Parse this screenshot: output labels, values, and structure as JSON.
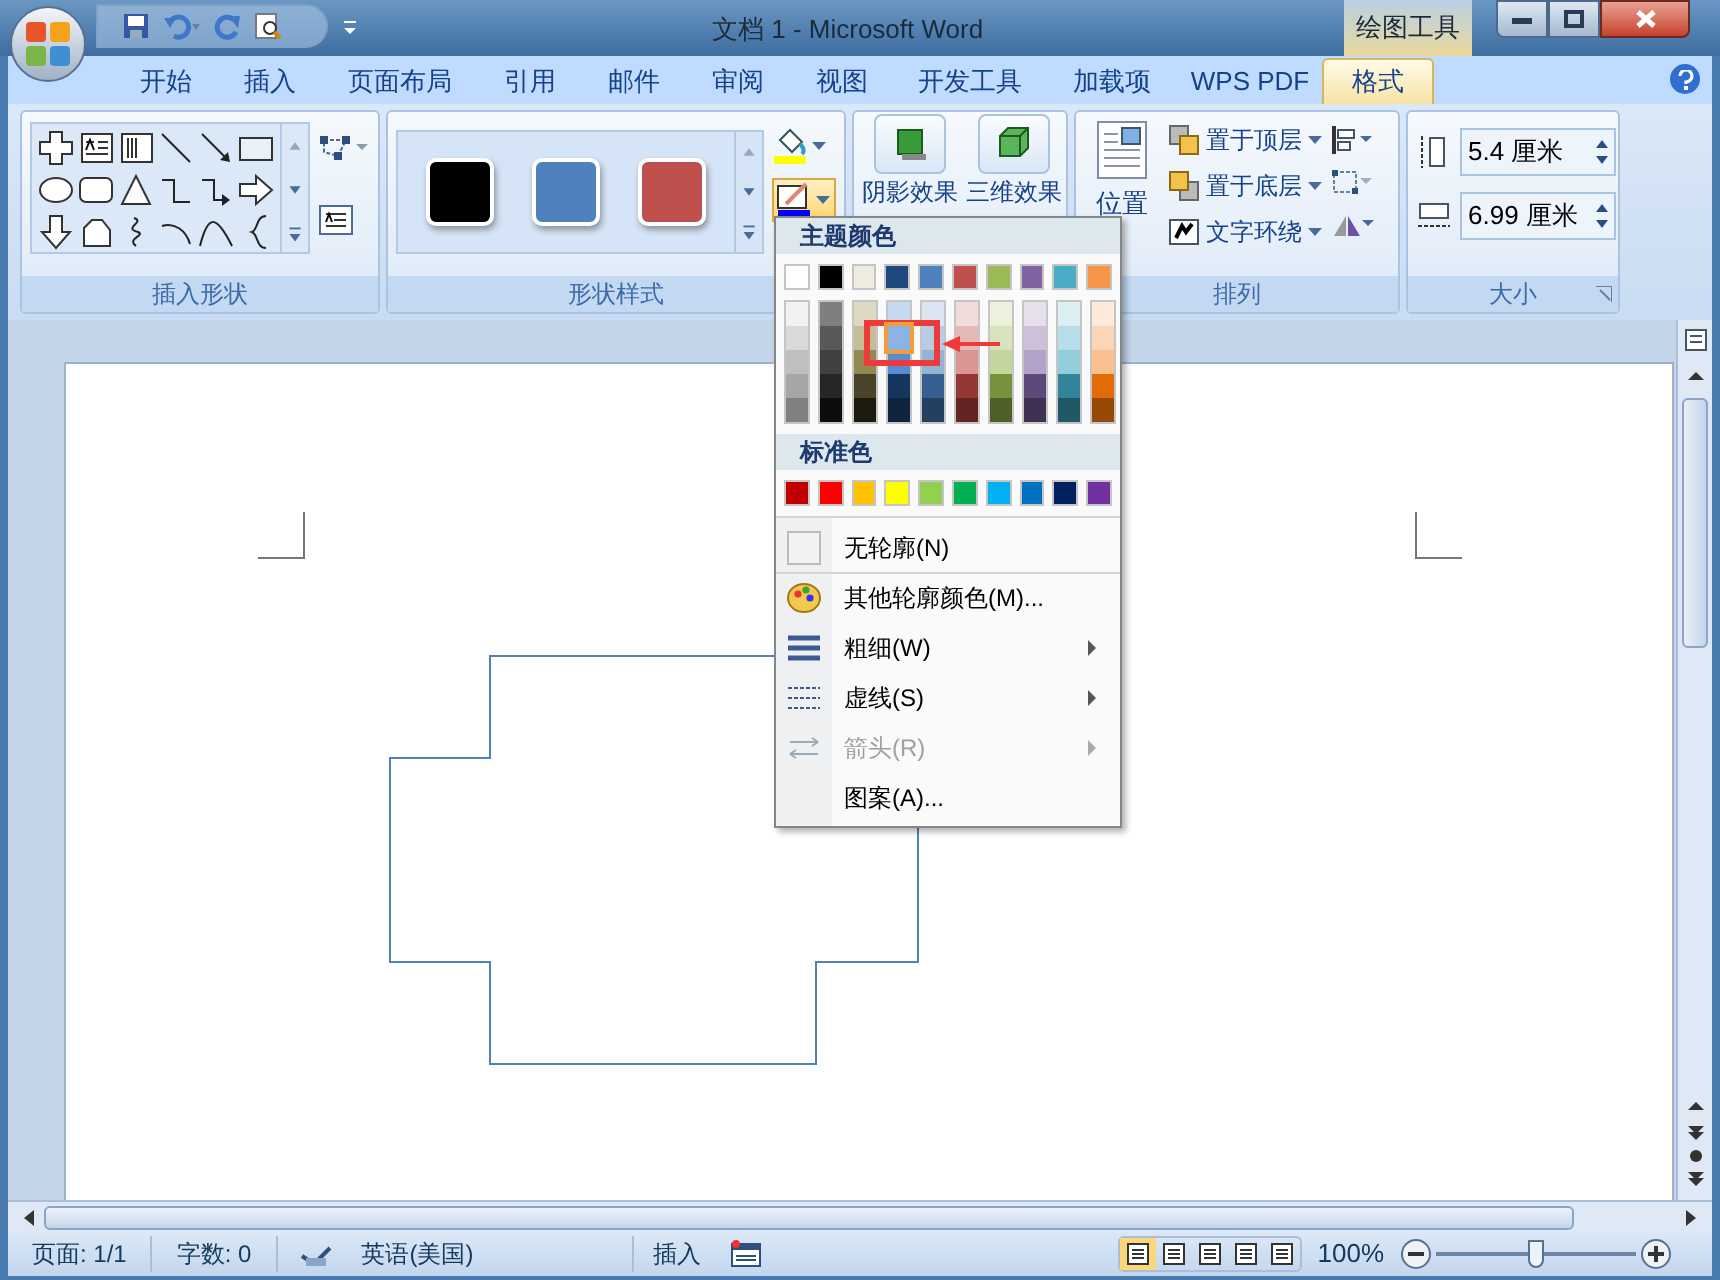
{
  "window": {
    "title": "文档 1 - Microsoft Word",
    "contextual_tab": "绘图工具"
  },
  "tabs": [
    {
      "label": "开始",
      "selected": false
    },
    {
      "label": "插入",
      "selected": false
    },
    {
      "label": "页面布局",
      "selected": false
    },
    {
      "label": "引用",
      "selected": false
    },
    {
      "label": "邮件",
      "selected": false
    },
    {
      "label": "审阅",
      "selected": false
    },
    {
      "label": "视图",
      "selected": false
    },
    {
      "label": "开发工具",
      "selected": false
    },
    {
      "label": "加载项",
      "selected": false
    },
    {
      "label": "WPS PDF",
      "selected": false
    },
    {
      "label": "格式",
      "selected": true
    }
  ],
  "ribbon": {
    "insert_shapes": {
      "label": "插入形状"
    },
    "shape_styles": {
      "label": "形状样式",
      "styles": [
        {
          "color": "#000000"
        },
        {
          "color": "#4f81bd"
        },
        {
          "color": "#c0504d"
        }
      ]
    },
    "effects": [
      {
        "label": "阴影效果"
      },
      {
        "label": "三维效果"
      }
    ],
    "arrange": {
      "label": "排列",
      "position": "位置",
      "items": [
        {
          "label": "置于顶层"
        },
        {
          "label": "置于底层"
        },
        {
          "label": "文字环绕"
        }
      ]
    },
    "size": {
      "label": "大小",
      "height": "5.4 厘米",
      "width": "6.99 厘米"
    }
  },
  "outline_menu": {
    "theme_heading": "主题颜色",
    "theme_colors": [
      {
        "color": "#ffffff"
      },
      {
        "color": "#000000"
      },
      {
        "color": "#eeece1"
      },
      {
        "color": "#1f497d"
      },
      {
        "color": "#4f81bd"
      },
      {
        "color": "#c0504d"
      },
      {
        "color": "#9bbb59"
      },
      {
        "color": "#8064a2"
      },
      {
        "color": "#4bacc6"
      },
      {
        "color": "#f79646"
      }
    ],
    "shades": [
      [
        {
          "color": "#f2f2f2",
          "selected": false
        },
        {
          "color": "#d9d9d9",
          "selected": false
        },
        {
          "color": "#bfbfbf",
          "selected": false
        },
        {
          "color": "#a6a6a6",
          "selected": false
        },
        {
          "color": "#808080",
          "selected": false
        }
      ],
      [
        {
          "color": "#7f7f7f",
          "selected": false
        },
        {
          "color": "#595959",
          "selected": false
        },
        {
          "color": "#404040",
          "selected": false
        },
        {
          "color": "#262626",
          "selected": false
        },
        {
          "color": "#0d0d0d",
          "selected": false
        }
      ],
      [
        {
          "color": "#ddd9c3",
          "selected": false
        },
        {
          "color": "#c4bd97",
          "selected": false
        },
        {
          "color": "#938953",
          "selected": false
        },
        {
          "color": "#494429",
          "selected": false
        },
        {
          "color": "#1d1b10",
          "selected": false
        }
      ],
      [
        {
          "color": "#c6d9f0",
          "selected": false
        },
        {
          "color": "#8db3e2",
          "selected": true
        },
        {
          "color": "#548dd4",
          "selected": false
        },
        {
          "color": "#17365d",
          "selected": false
        },
        {
          "color": "#0f243e",
          "selected": false
        }
      ],
      [
        {
          "color": "#dbe5f1",
          "selected": false
        },
        {
          "color": "#b8cce4",
          "selected": false
        },
        {
          "color": "#95b3d7",
          "selected": false
        },
        {
          "color": "#366092",
          "selected": false
        },
        {
          "color": "#244061",
          "selected": false
        }
      ],
      [
        {
          "color": "#f2dcdb",
          "selected": false
        },
        {
          "color": "#e5b9b7",
          "selected": false
        },
        {
          "color": "#d99694",
          "selected": false
        },
        {
          "color": "#953734",
          "selected": false
        },
        {
          "color": "#632423",
          "selected": false
        }
      ],
      [
        {
          "color": "#ebf1dd",
          "selected": false
        },
        {
          "color": "#d7e3bc",
          "selected": false
        },
        {
          "color": "#c3d69b",
          "selected": false
        },
        {
          "color": "#76923c",
          "selected": false
        },
        {
          "color": "#4f6128",
          "selected": false
        }
      ],
      [
        {
          "color": "#e5e0ec",
          "selected": false
        },
        {
          "color": "#ccc1d9",
          "selected": false
        },
        {
          "color": "#b2a2c7",
          "selected": false
        },
        {
          "color": "#5f497a",
          "selected": false
        },
        {
          "color": "#3f3151",
          "selected": false
        }
      ],
      [
        {
          "color": "#dbeef3",
          "selected": false
        },
        {
          "color": "#b7dde8",
          "selected": false
        },
        {
          "color": "#92cddc",
          "selected": false
        },
        {
          "color": "#31859b",
          "selected": false
        },
        {
          "color": "#205867",
          "selected": false
        }
      ],
      [
        {
          "color": "#fdeada",
          "selected": false
        },
        {
          "color": "#fbd5b5",
          "selected": false
        },
        {
          "color": "#fac08f",
          "selected": false
        },
        {
          "color": "#e36c09",
          "selected": false
        },
        {
          "color": "#974806",
          "selected": false
        }
      ]
    ],
    "standard_heading": "标准色",
    "standard_colors": [
      {
        "color": "#c00000"
      },
      {
        "color": "#ff0000"
      },
      {
        "color": "#ffc000"
      },
      {
        "color": "#ffff00"
      },
      {
        "color": "#92d050"
      },
      {
        "color": "#00b050"
      },
      {
        "color": "#00b0f0"
      },
      {
        "color": "#0070c0"
      },
      {
        "color": "#002060"
      },
      {
        "color": "#7030a0"
      }
    ],
    "items": [
      {
        "kind": "none",
        "label": "无轮廓(N)",
        "disabled": false,
        "submenu": false
      },
      {
        "kind": "more",
        "label": "其他轮廓颜色(M)...",
        "disabled": false,
        "submenu": false
      },
      {
        "kind": "weight",
        "label": "粗细(W)",
        "disabled": false,
        "submenu": true
      },
      {
        "kind": "dash",
        "label": "虚线(S)",
        "disabled": false,
        "submenu": true
      },
      {
        "kind": "arrows",
        "label": "箭头(R)",
        "disabled": true,
        "submenu": true
      },
      {
        "kind": "pattern",
        "label": "图案(A)...",
        "disabled": false,
        "submenu": false
      }
    ]
  },
  "status_bar": {
    "page": "页面: 1/1",
    "words": "字数: 0",
    "language": "英语(美国)",
    "mode": "插入",
    "zoom": "100%",
    "zoom_level": {
      "level": 0.5
    }
  }
}
